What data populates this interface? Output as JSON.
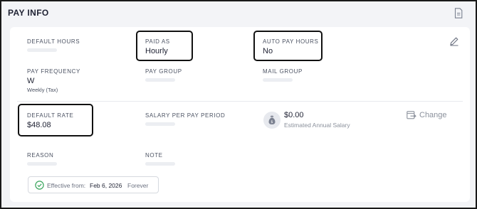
{
  "header": {
    "title": "PAY INFO",
    "icon": "document-icon"
  },
  "fields": {
    "default_hours": {
      "label": "DEFAULT HOURS",
      "value": ""
    },
    "paid_as": {
      "label": "PAID AS",
      "value": "Hourly"
    },
    "auto_pay_hours": {
      "label": "AUTO PAY HOURS",
      "value": "No"
    },
    "pay_frequency": {
      "label": "PAY FREQUENCY",
      "value": "W",
      "sub": "Weekly (Tax)"
    },
    "pay_group": {
      "label": "PAY GROUP",
      "value": ""
    },
    "mail_group": {
      "label": "MAIL GROUP",
      "value": ""
    },
    "default_rate": {
      "label": "DEFAULT RATE",
      "value": "$48.08"
    },
    "salary_per_pay_period": {
      "label": "SALARY PER PAY PERIOD",
      "value": ""
    },
    "reason": {
      "label": "REASON",
      "value": ""
    },
    "note": {
      "label": "NOTE",
      "value": ""
    }
  },
  "annual_salary": {
    "amount": "$0.00",
    "label": "Estimated Annual Salary",
    "icon": "money-bag-icon"
  },
  "change_button": {
    "label": "Change",
    "icon": "calendar-arrow-icon"
  },
  "edit_button": {
    "icon": "pencil-icon"
  },
  "effective": {
    "label": "Effective from:",
    "date": "Feb 6, 2026",
    "until": "Forever",
    "icon": "check-circle-icon"
  },
  "colors": {
    "highlight_border": "#111111",
    "page_background": "#f3f4f7",
    "card_background": "#ffffff",
    "check_green": "#3aa55d"
  }
}
